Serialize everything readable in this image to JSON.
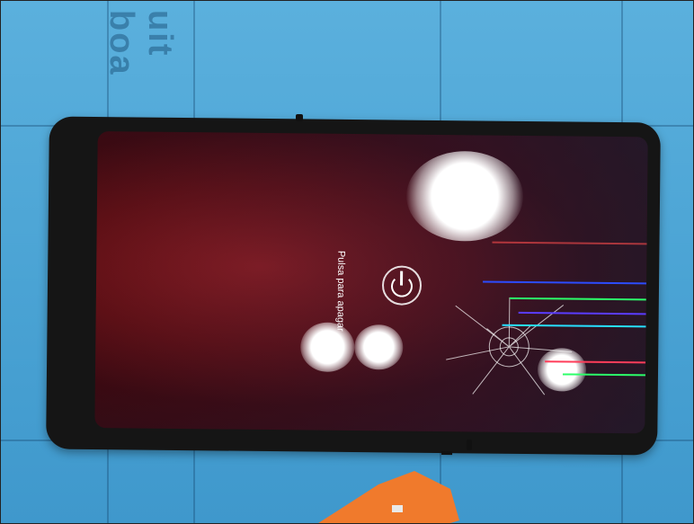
{
  "photo": {
    "mat_print": "uit boa",
    "lock_screen_text": "Pulsa para apagar",
    "icons": [
      "power-icon"
    ],
    "colors": {
      "mat": "#4aa3d4",
      "screen_red": "#8a1c22",
      "tool_orange": "#f07a2c"
    }
  }
}
